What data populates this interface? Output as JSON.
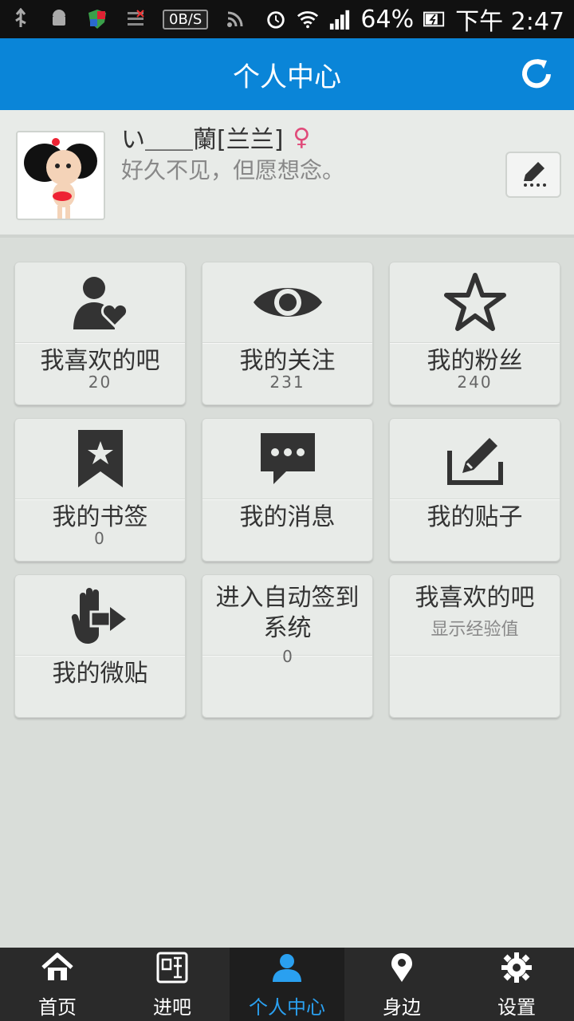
{
  "statusbar": {
    "network_speed": "0B/S",
    "battery": "64%",
    "time": "下午 2:47"
  },
  "header": {
    "title": "个人中心",
    "refresh_icon": "refresh-icon"
  },
  "profile": {
    "username": "い＿＿蘭[兰兰]",
    "gender_symbol": "♀",
    "signature": "好久不见，但愿想念。",
    "edit_icon": "edit-icon"
  },
  "tiles": [
    {
      "label": "我喜欢的吧",
      "count": "20",
      "icon": "user-heart-icon"
    },
    {
      "label": "我的关注",
      "count": "231",
      "icon": "eye-icon"
    },
    {
      "label": "我的粉丝",
      "count": "240",
      "icon": "star-icon"
    },
    {
      "label": "我的书签",
      "count": "0",
      "icon": "bookmark-icon"
    },
    {
      "label": "我的消息",
      "count": "",
      "icon": "message-icon"
    },
    {
      "label": "我的贴子",
      "count": "",
      "icon": "post-edit-icon"
    },
    {
      "label": "我的微贴",
      "count": "",
      "icon": "hand-share-icon"
    },
    {
      "label": "进入自动签到系统",
      "count": "0"
    },
    {
      "label": "我喜欢的吧",
      "sub": "显示经验值"
    }
  ],
  "nav": {
    "items": [
      {
        "label": "首页",
        "icon": "home-icon"
      },
      {
        "label": "进吧",
        "icon": "tie-icon"
      },
      {
        "label": "个人中心",
        "icon": "person-icon"
      },
      {
        "label": "身边",
        "icon": "location-icon"
      },
      {
        "label": "设置",
        "icon": "gear-icon"
      }
    ],
    "active_index": 2
  },
  "colors": {
    "header_blue": "#0a85d8",
    "active_nav": "#2aa0f0",
    "female_pink": "#e04b7a"
  }
}
